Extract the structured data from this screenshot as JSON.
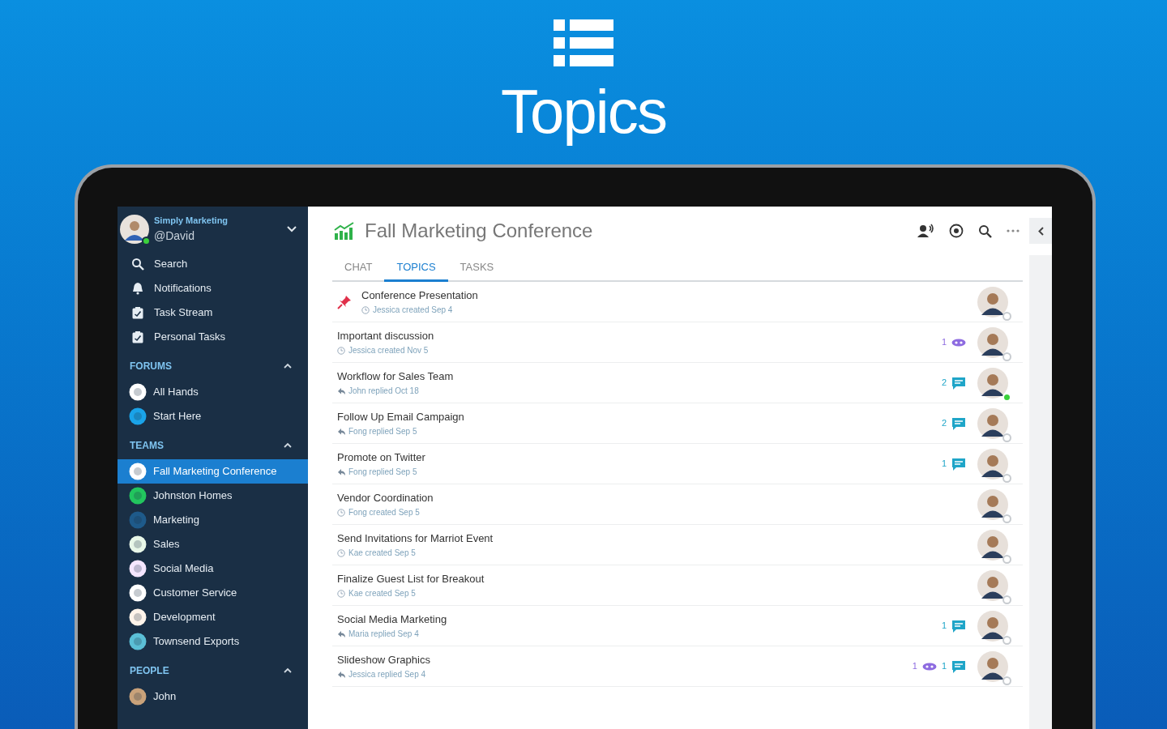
{
  "hero": {
    "title": "Topics"
  },
  "sidebar": {
    "account": {
      "workspace": "Simply Marketing",
      "handle": "@David",
      "online": true
    },
    "nav": [
      {
        "label": "Search",
        "kind": "search"
      },
      {
        "label": "Notifications",
        "kind": "bell"
      },
      {
        "label": "Task Stream",
        "kind": "task"
      },
      {
        "label": "Personal Tasks",
        "kind": "task"
      }
    ],
    "sections": [
      {
        "title": "FORUMS",
        "expanded": true,
        "items": [
          {
            "label": "All Hands",
            "selected": false,
            "color": "#ffffff"
          },
          {
            "label": "Start Here",
            "selected": false,
            "color": "#1aa3e8"
          }
        ]
      },
      {
        "title": "TEAMS",
        "expanded": true,
        "items": [
          {
            "label": "Fall Marketing Conference",
            "selected": true,
            "color": "#ffffff"
          },
          {
            "label": "Johnston Homes",
            "selected": false,
            "color": "#22c55e"
          },
          {
            "label": "Marketing",
            "selected": false,
            "color": "#1e5a8a"
          },
          {
            "label": "Sales",
            "selected": false,
            "color": "#e8f7e8"
          },
          {
            "label": "Social Media",
            "selected": false,
            "color": "#f5e6ff"
          },
          {
            "label": "Customer Service",
            "selected": false,
            "color": "#ffffff"
          },
          {
            "label": "Development",
            "selected": false,
            "color": "#fff4ea"
          },
          {
            "label": "Townsend Exports",
            "selected": false,
            "color": "#5bbfd6"
          }
        ]
      },
      {
        "title": "PEOPLE",
        "expanded": true,
        "items": [
          {
            "label": "John",
            "selected": false,
            "color": "#c9a27a"
          }
        ]
      }
    ]
  },
  "main": {
    "title": "Fall Marketing Conference",
    "tabs": [
      {
        "label": "CHAT",
        "selected": false
      },
      {
        "label": "TOPICS",
        "selected": true
      },
      {
        "label": "TASKS",
        "selected": false
      }
    ],
    "topics": [
      {
        "title": "Conference Presentation",
        "meta": "Jessica created Sep 4",
        "kind": "created",
        "pinned": true,
        "online": false
      },
      {
        "title": "Important discussion",
        "meta": "Jessica created Nov 5",
        "kind": "created",
        "pinned": false,
        "likes": "1",
        "online": false
      },
      {
        "title": "Workflow for Sales Team",
        "meta": "John replied Oct 18",
        "kind": "replied",
        "pinned": false,
        "comments": "2",
        "online": true
      },
      {
        "title": "Follow Up Email Campaign",
        "meta": "Fong replied Sep 5",
        "kind": "replied",
        "pinned": false,
        "comments": "2",
        "online": false
      },
      {
        "title": "Promote on Twitter",
        "meta": "Fong replied Sep 5",
        "kind": "replied",
        "pinned": false,
        "comments": "1",
        "online": false
      },
      {
        "title": "Vendor Coordination",
        "meta": "Fong created Sep 5",
        "kind": "created",
        "pinned": false,
        "online": false
      },
      {
        "title": "Send Invitations for Marriot Event",
        "meta": "Kae created Sep 5",
        "kind": "created",
        "pinned": false,
        "online": false
      },
      {
        "title": "Finalize Guest List for Breakout",
        "meta": "Kae created Sep 5",
        "kind": "created",
        "pinned": false,
        "online": false
      },
      {
        "title": "Social Media Marketing",
        "meta": "Maria replied Sep 4",
        "kind": "replied",
        "pinned": false,
        "comments": "1",
        "online": false
      },
      {
        "title": "Slideshow Graphics",
        "meta": "Jessica replied Sep 4",
        "kind": "replied",
        "pinned": false,
        "likes": "1",
        "comments": "1",
        "online": false
      }
    ]
  }
}
